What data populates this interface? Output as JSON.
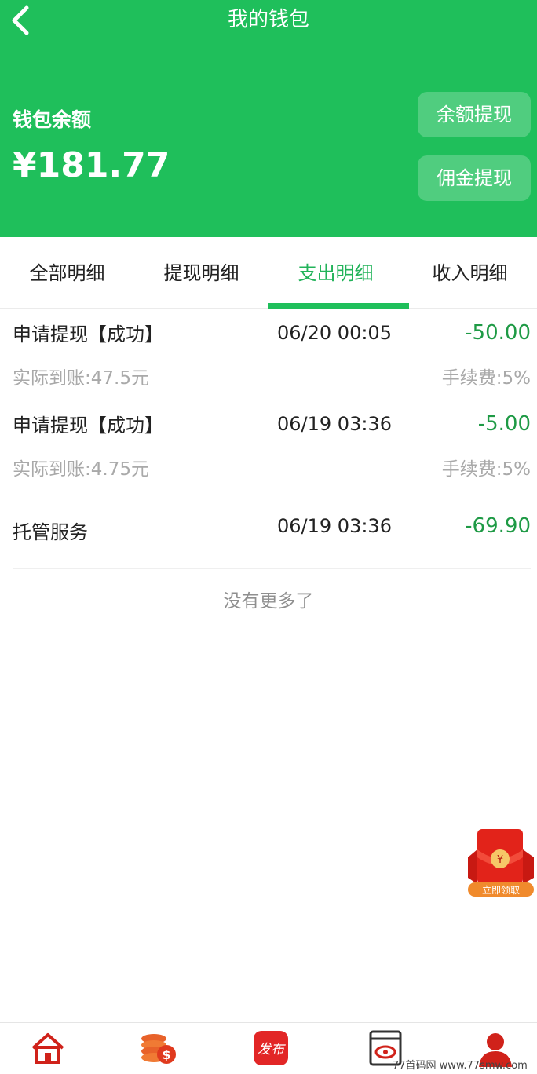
{
  "header": {
    "title": "我的钱包",
    "balance_label": "钱包余额",
    "balance_amount": "¥181.77",
    "withdraw_balance_label": "余额提现",
    "withdraw_commission_label": "佣金提现"
  },
  "tabs": [
    {
      "label": "全部明细",
      "active": false
    },
    {
      "label": "提现明细",
      "active": false
    },
    {
      "label": "支出明细",
      "active": true
    },
    {
      "label": "收入明细",
      "active": false
    }
  ],
  "transactions": [
    {
      "title": "申请提现【成功】",
      "date": "06/20 00:05",
      "amount": "-50.00",
      "actual": "实际到账:47.5元",
      "fee": "手续费:5%"
    },
    {
      "title": "申请提现【成功】",
      "date": "06/19 03:36",
      "amount": "-5.00",
      "actual": "实际到账:4.75元",
      "fee": "手续费:5%"
    },
    {
      "title": "托管服务",
      "date": "06/19 03:36",
      "amount": "-69.90"
    }
  ],
  "no_more_text": "没有更多了",
  "red_packet": {
    "label": "立即领取",
    "symbol": "¥"
  },
  "bottom_nav": {
    "publish_label": "发布",
    "icons": [
      "home-icon",
      "coins-icon",
      "publish-icon",
      "eye-card-icon",
      "user-icon"
    ]
  },
  "watermark": "77首码网 www.77smw.com",
  "colors": {
    "primary": "#1fbf5b",
    "amount": "#1e9a45",
    "accent_red": "#e53935"
  }
}
